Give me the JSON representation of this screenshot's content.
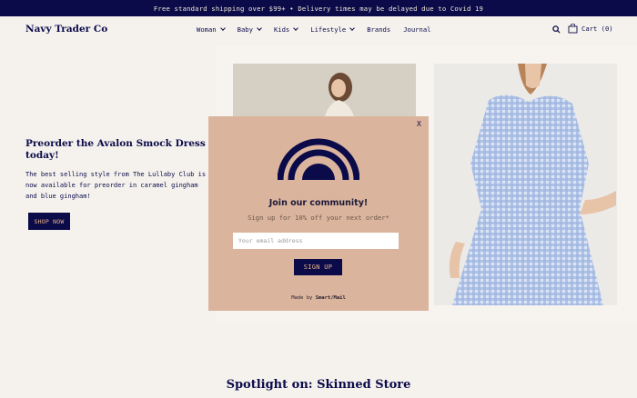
{
  "announcement": "Free standard shipping over $99+ • Delivery times may be delayed due to Covid 19",
  "header": {
    "logo": "Navy Trader Co",
    "nav": [
      "Woman",
      "Baby",
      "Kids",
      "Lifestyle",
      "Brands",
      "Journal"
    ],
    "cart_label": "Cart (0)"
  },
  "promo": {
    "title": "Preorder the Avalon Smock Dress today!",
    "text": "The best selling style from The Lullaby Club is now available for preorder in caramel gingham and blue gingham!",
    "button": "SHOP NOW"
  },
  "popup": {
    "close": "X",
    "title": "Join our community!",
    "subtitle": "Sign up for 10% off your next order*",
    "email_placeholder": "Your email address",
    "button": "SIGN UP",
    "made_by_prefix": "Made by",
    "made_by_brand": "Smart/Mail"
  },
  "spotlight": "Spotlight on: Skinned Store",
  "colors": {
    "navy": "#0b0b4a",
    "popup_bg": "#dbb49d",
    "accent": "#e8b487"
  },
  "icons": [
    "search-icon",
    "cart-icon",
    "chevron-down-icon",
    "rainbow-logo-icon"
  ]
}
